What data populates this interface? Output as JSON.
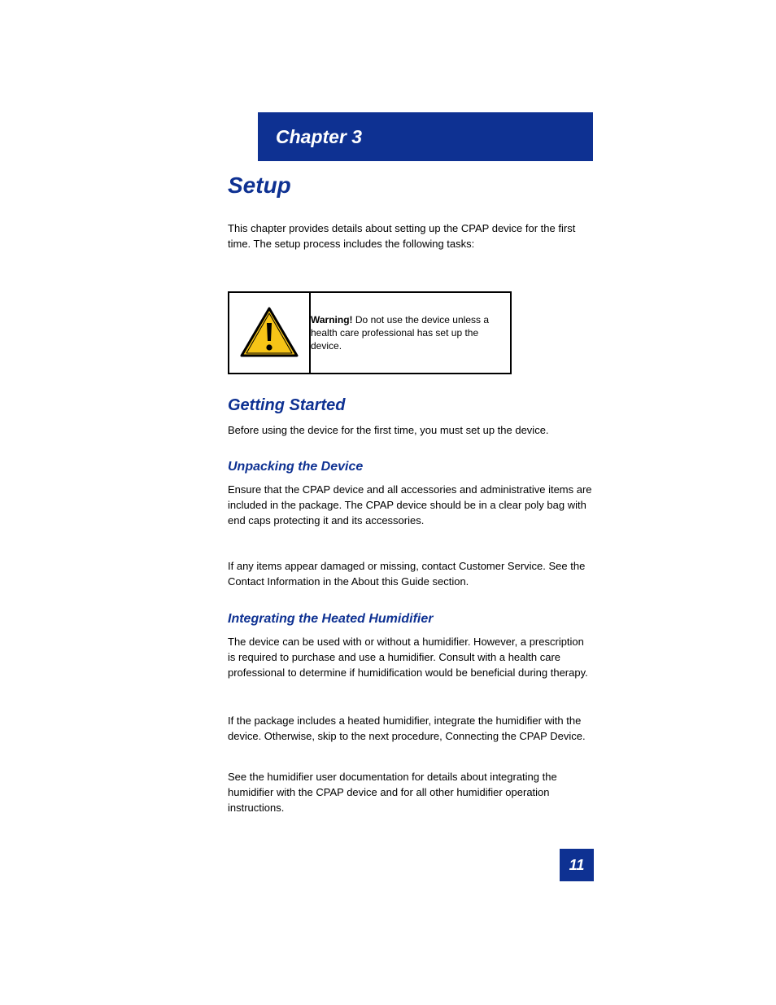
{
  "banner": {
    "label": "Chapter 3"
  },
  "chapter": {
    "title": "Setup"
  },
  "intro": {
    "text": "This chapter provides details about setting up the CPAP device for the first time. The setup process includes the following tasks:"
  },
  "warning": {
    "label": "Warning!",
    "text": "Do not use the device unless a health care professional has set up the device."
  },
  "sections": {
    "getting_started": {
      "heading": "Getting Started",
      "body": "Before using the device for the first time, you must set up the device."
    },
    "unpacking": {
      "heading": "Unpacking the Device",
      "p1": "Ensure that the CPAP device and all accessories and administrative items are included in the package. The CPAP device should be in a clear poly bag with end caps protecting it and its accessories.",
      "p2": "If any items appear damaged or missing, contact Customer Service. See the Contact Information in the About this Guide section."
    },
    "humidifier": {
      "heading": "Integrating the Heated Humidifier",
      "p1": "The device can be used with or without a humidifier. However, a prescription is required to purchase and use a humidifier. Consult with a health care professional to determine if humidification would be beneficial during therapy.",
      "p2": "If the package includes a heated humidifier, integrate the humidifier with the device. Otherwise, skip to the next procedure, Connecting the CPAP Device.",
      "p3": "See the humidifier user documentation for details about integrating the humidifier with the CPAP device and for all other humidifier operation instructions."
    }
  },
  "page_number": "11"
}
